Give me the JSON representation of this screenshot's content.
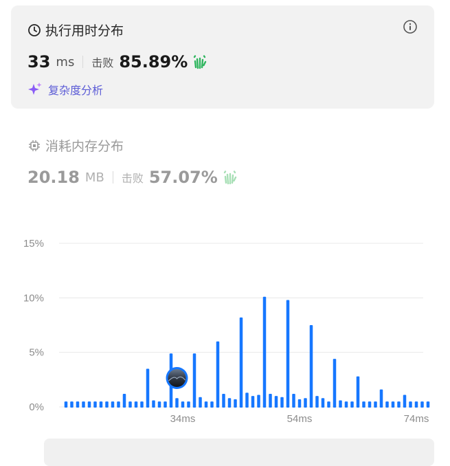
{
  "runtime": {
    "title": "执行用时分布",
    "value": "33",
    "unit": "ms",
    "beats_label": "击败",
    "beats_value": "85.89%",
    "analysis_label": "复杂度分析",
    "clock_icon": "clock-icon",
    "info_icon": "info-icon",
    "clap_icon": "clap-icon"
  },
  "memory": {
    "title": "消耗内存分布",
    "value": "20.18",
    "unit": "MB",
    "beats_label": "击败",
    "beats_value": "57.07%",
    "chip_icon": "chip-icon"
  },
  "colors": {
    "bar": "#1677ff",
    "clap_active": "#2db55d",
    "clap_inactive": "#a7dfb5",
    "analysis": "#5b5bd6"
  },
  "chart_data": {
    "type": "bar",
    "title": "",
    "xlabel": "",
    "ylabel": "",
    "ylim": [
      0,
      15
    ],
    "yticks": [
      0,
      5,
      10,
      15
    ],
    "ytick_labels": [
      "0%",
      "5%",
      "10%",
      "15%"
    ],
    "xticks": [
      34,
      54,
      74
    ],
    "xtick_labels": [
      "34ms",
      "54ms",
      "74ms"
    ],
    "grid": true,
    "x": [
      14,
      15,
      16,
      17,
      18,
      19,
      20,
      21,
      22,
      23,
      24,
      25,
      26,
      27,
      28,
      29,
      30,
      31,
      32,
      33,
      34,
      35,
      36,
      37,
      38,
      39,
      40,
      41,
      42,
      43,
      44,
      45,
      46,
      47,
      48,
      49,
      50,
      51,
      52,
      53,
      54,
      55,
      56,
      57,
      58,
      59,
      60,
      61,
      62,
      63,
      64,
      65,
      66,
      67,
      68,
      69,
      70,
      71,
      72,
      73,
      74,
      75,
      76
    ],
    "values": [
      0.5,
      0.5,
      0.5,
      0.5,
      0.5,
      0.5,
      0.5,
      0.5,
      0.5,
      0.5,
      1.2,
      0.5,
      0.5,
      0.5,
      3.5,
      0.6,
      0.5,
      0.5,
      4.9,
      0.8,
      0.5,
      0.5,
      4.9,
      0.9,
      0.5,
      0.5,
      6.0,
      1.2,
      0.8,
      0.7,
      8.2,
      1.3,
      1.0,
      1.1,
      10.1,
      1.2,
      1.0,
      0.9,
      9.8,
      1.2,
      0.7,
      0.8,
      7.5,
      1.0,
      0.8,
      0.5,
      4.4,
      0.6,
      0.5,
      0.5,
      2.8,
      0.5,
      0.5,
      0.5,
      1.6,
      0.5,
      0.5,
      0.5,
      1.1,
      0.5,
      0.5,
      0.5,
      0.5
    ],
    "highlight_x": 33
  }
}
